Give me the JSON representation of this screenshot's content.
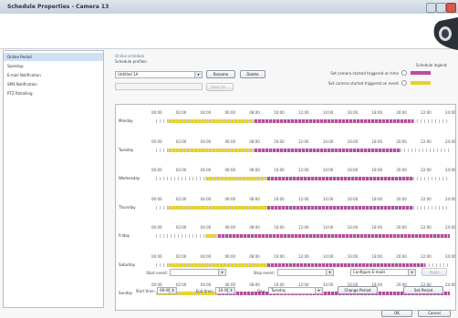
{
  "window": {
    "title": "Schedule Properties - Camera 13"
  },
  "sidebar": {
    "items": [
      {
        "label": "Online Period",
        "selected": true
      },
      {
        "label": "Speedup",
        "selected": false
      },
      {
        "label": "E-mail Notification",
        "selected": false
      },
      {
        "label": "SMS Notification",
        "selected": false
      },
      {
        "label": "PTZ Patrolling",
        "selected": false
      }
    ]
  },
  "schedule": {
    "section_title": "Online schedule",
    "profiles_label": "Schedule profiles:",
    "profile_value": "Untitled 1A",
    "rename_label": "Rename",
    "delete_label": "Delete",
    "save_as_label": "Save As...",
    "legend_title": "Schedule legend:",
    "legend_items": [
      {
        "label": "Set camera started triggered on time",
        "color": "#c0489c"
      },
      {
        "label": "Set camera started triggered on event",
        "color": "#e6d12a"
      }
    ],
    "ticks": [
      "00:00",
      "02:00",
      "04:00",
      "06:00",
      "08:00",
      "10:00",
      "12:00",
      "14:00",
      "16:00",
      "18:00",
      "20:00",
      "22:00",
      "24:00"
    ],
    "days": [
      {
        "name": "Monday",
        "segments": [
          [
            "empty",
            0,
            1
          ],
          [
            "yellow",
            1,
            8
          ],
          [
            "purple",
            8,
            21
          ],
          [
            "empty",
            21,
            24
          ]
        ]
      },
      {
        "name": "Tuesday",
        "segments": [
          [
            "empty",
            0,
            1
          ],
          [
            "yellow",
            1,
            8
          ],
          [
            "purple",
            8,
            20
          ],
          [
            "empty",
            20,
            24
          ]
        ]
      },
      {
        "name": "Wednesday",
        "segments": [
          [
            "empty",
            0,
            4
          ],
          [
            "yellow",
            4,
            9
          ],
          [
            "purple",
            9,
            21
          ],
          [
            "empty",
            21,
            24
          ]
        ]
      },
      {
        "name": "Thursday",
        "segments": [
          [
            "empty",
            0,
            1
          ],
          [
            "yellow",
            1,
            9
          ],
          [
            "purple",
            9,
            21
          ],
          [
            "empty",
            21,
            24
          ]
        ]
      },
      {
        "name": "Friday",
        "segments": [
          [
            "empty",
            0,
            4
          ],
          [
            "yellow",
            4,
            5
          ],
          [
            "purple",
            5,
            24
          ]
        ]
      },
      {
        "name": "Saturday",
        "segments": [
          [
            "empty",
            0,
            1
          ],
          [
            "yellow",
            1,
            9
          ],
          [
            "purple",
            9,
            22
          ],
          [
            "empty",
            22,
            24
          ]
        ]
      },
      {
        "name": "Sunday",
        "segments": [
          [
            "yellow",
            0,
            5
          ],
          [
            "purple",
            5,
            24
          ]
        ]
      }
    ],
    "colors": {
      "purple": "#b94aa0",
      "yellow": "#e8d21f",
      "empty": "#ffffff"
    }
  },
  "controls": {
    "start_event_label": "Start event:",
    "stop_event_label": "Stop event:",
    "configure_label": "Configure E-mails",
    "apply_label": "Apply",
    "start_time_label": "Start time:",
    "start_time_value": "08:00",
    "end_time_label": "End time:",
    "end_time_value": "16:00",
    "day_label": "Day:",
    "day_value": "Tuesday",
    "change_period_label": "Change Period",
    "set_period_label": "Set Period"
  },
  "footer": {
    "ok_label": "OK",
    "cancel_label": "Cancel"
  }
}
